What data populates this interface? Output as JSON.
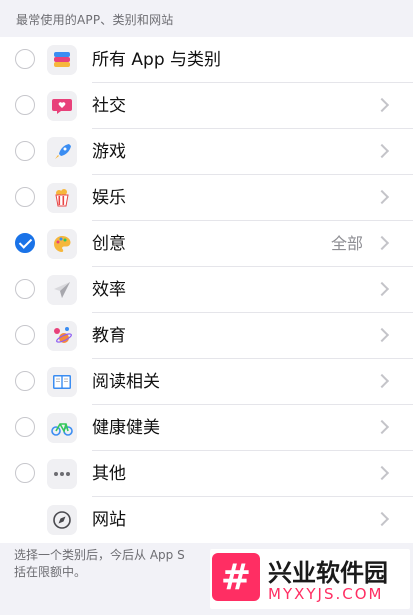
{
  "section_header": "最常使用的APP、类别和网站",
  "rows": [
    {
      "label": "所有 App 与类别",
      "icon": "stack-icon",
      "checked": false,
      "value": "",
      "has_chevron": false,
      "has_radio": true
    },
    {
      "label": "社交",
      "icon": "chat-heart-icon",
      "checked": false,
      "value": "",
      "has_chevron": true,
      "has_radio": true
    },
    {
      "label": "游戏",
      "icon": "rocket-icon",
      "checked": false,
      "value": "",
      "has_chevron": true,
      "has_radio": true
    },
    {
      "label": "娱乐",
      "icon": "popcorn-icon",
      "checked": false,
      "value": "",
      "has_chevron": true,
      "has_radio": true
    },
    {
      "label": "创意",
      "icon": "palette-icon",
      "checked": true,
      "value": "全部",
      "has_chevron": true,
      "has_radio": true
    },
    {
      "label": "效率",
      "icon": "paper-plane-icon",
      "checked": false,
      "value": "",
      "has_chevron": true,
      "has_radio": true
    },
    {
      "label": "教育",
      "icon": "planet-icon",
      "checked": false,
      "value": "",
      "has_chevron": true,
      "has_radio": true
    },
    {
      "label": "阅读相关",
      "icon": "book-icon",
      "checked": false,
      "value": "",
      "has_chevron": true,
      "has_radio": true
    },
    {
      "label": "健康健美",
      "icon": "bicycle-icon",
      "checked": false,
      "value": "",
      "has_chevron": true,
      "has_radio": true
    },
    {
      "label": "其他",
      "icon": "ellipsis-icon",
      "checked": false,
      "value": "",
      "has_chevron": true,
      "has_radio": true
    },
    {
      "label": "网站",
      "icon": "compass-icon",
      "checked": false,
      "value": "",
      "has_chevron": true,
      "has_radio": false
    }
  ],
  "footer_text": "选择一个类别后，今后从 App S\n括在限额中。",
  "watermark": {
    "logo_char": "#",
    "title": "兴业软件园",
    "subtitle": "MYXYJS.COM"
  },
  "colors": {
    "accent": "#1a73e8",
    "background": "#f2f2f7",
    "watermark_pink": "#ff2e63"
  }
}
